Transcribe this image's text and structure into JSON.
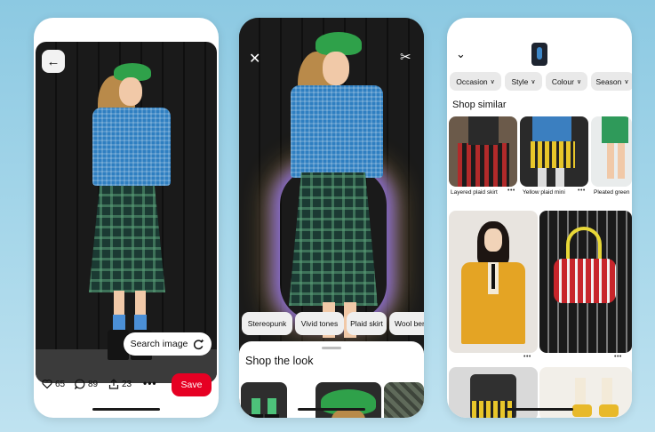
{
  "phone1": {
    "search_image_label": "Search image",
    "likes": "65",
    "comments": "89",
    "shares": "23",
    "more": "•••",
    "save_label": "Save"
  },
  "phone2": {
    "tags": [
      "Stereopunk",
      "Vivid tones",
      "Plaid skirt",
      "Wool beret"
    ],
    "shop_the_look_title": "Shop the look"
  },
  "phone3": {
    "filters": [
      "Occasion",
      "Style",
      "Colour",
      "Season"
    ],
    "shop_similar_title": "Shop similar",
    "similar_items": [
      {
        "label": "Layered plaid skirt",
        "more": "•••"
      },
      {
        "label": "Yellow plaid mini",
        "more": "•••"
      },
      {
        "label": "Pleated green",
        "more": ""
      }
    ],
    "more": "•••"
  },
  "colors": {
    "save": "#e60023",
    "background": "#a7d7ea",
    "beret": "#2fa14a"
  }
}
